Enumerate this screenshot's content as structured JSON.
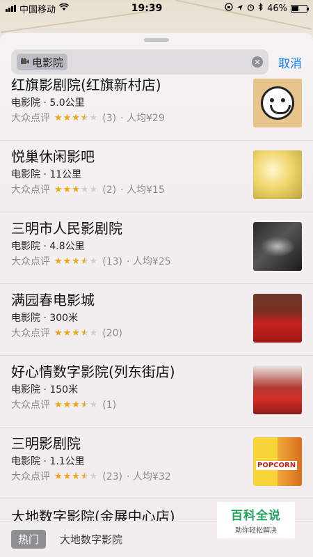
{
  "status_bar": {
    "carrier": "中国移动",
    "time": "19:39",
    "battery": "46%",
    "battery_level": 0.46
  },
  "search": {
    "token_label": "电影院",
    "cancel_label": "取消"
  },
  "results": [
    {
      "name": "红旗影剧院(红旗新村店)",
      "category": "电影院",
      "distance": "5.0公里",
      "source": "大众点评",
      "rating": 3.5,
      "reviews": "(3)",
      "price": "· 人均¥29"
    },
    {
      "name": "悦巢休闲影吧",
      "category": "电影院",
      "distance": "11公里",
      "source": "大众点评",
      "rating": 3.0,
      "reviews": "(2)",
      "price": "· 人均¥15"
    },
    {
      "name": "三明市人民影剧院",
      "category": "电影院",
      "distance": "4.8公里",
      "source": "大众点评",
      "rating": 3.5,
      "reviews": "(13)",
      "price": "· 人均¥25"
    },
    {
      "name": "满园春电影城",
      "category": "电影院",
      "distance": "300米",
      "source": "大众点评",
      "rating": 3.5,
      "reviews": "(20)",
      "price": ""
    },
    {
      "name": "好心情数字影院(列东街店)",
      "category": "电影院",
      "distance": "150米",
      "source": "大众点评",
      "rating": 3.5,
      "reviews": "(1)",
      "price": ""
    },
    {
      "name": "三明影剧院",
      "category": "电影院",
      "distance": "1.1公里",
      "source": "大众点评",
      "rating": 3.5,
      "reviews": "(23)",
      "price": "· 人均¥32"
    }
  ],
  "partial_item": {
    "name": "大地数字影院(金展中心店)"
  },
  "bottom_bar": {
    "hot_label": "热门",
    "suggestion": "大地数字影院"
  },
  "watermark": {
    "main": "百科全说",
    "sub": "助你轻松解决"
  },
  "colors": {
    "accent": "#147efb",
    "star": "#f4a70b",
    "watermark": "#1fa35a"
  },
  "icons": [
    "signal-icon",
    "wifi-icon",
    "lock-rotation-icon",
    "location-icon",
    "alarm-icon",
    "bluetooth-icon",
    "battery-icon",
    "film-icon",
    "clear-icon",
    "star-icon"
  ]
}
